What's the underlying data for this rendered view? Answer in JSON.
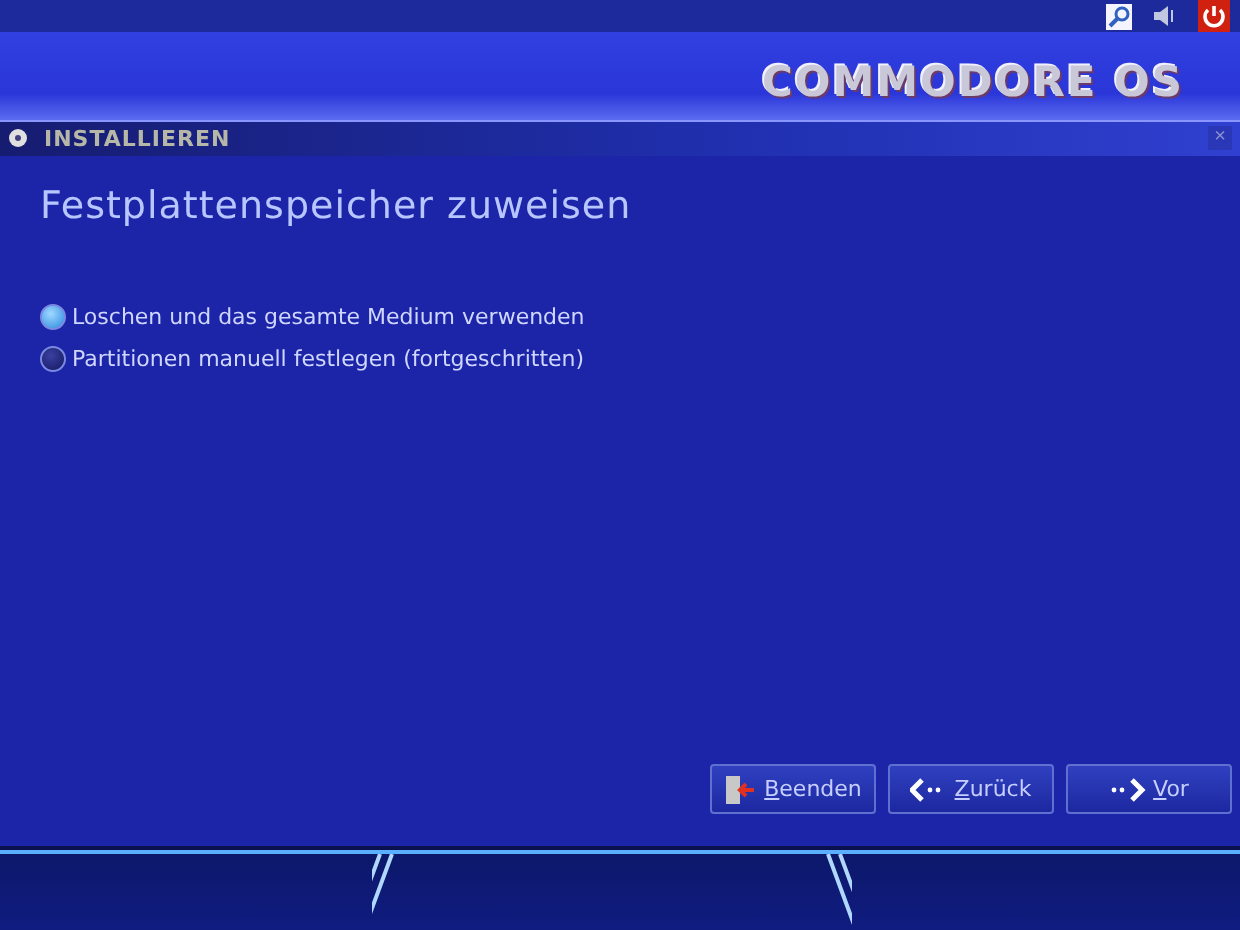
{
  "logo": {
    "text": "COMMODORE OS"
  },
  "window": {
    "title": "INSTALLIEREN",
    "close": "×"
  },
  "heading": "Festplattenspeicher zuweisen",
  "options": [
    {
      "label": "Loschen und das gesamte Medium verwenden",
      "selected": true
    },
    {
      "label": "Partitionen manuell festlegen (fortgeschritten)",
      "selected": false
    }
  ],
  "buttons": [
    {
      "label": "Beenden",
      "kind": "quit"
    },
    {
      "label": "Zurück",
      "kind": "back"
    },
    {
      "label": "Vor",
      "kind": "next"
    }
  ]
}
